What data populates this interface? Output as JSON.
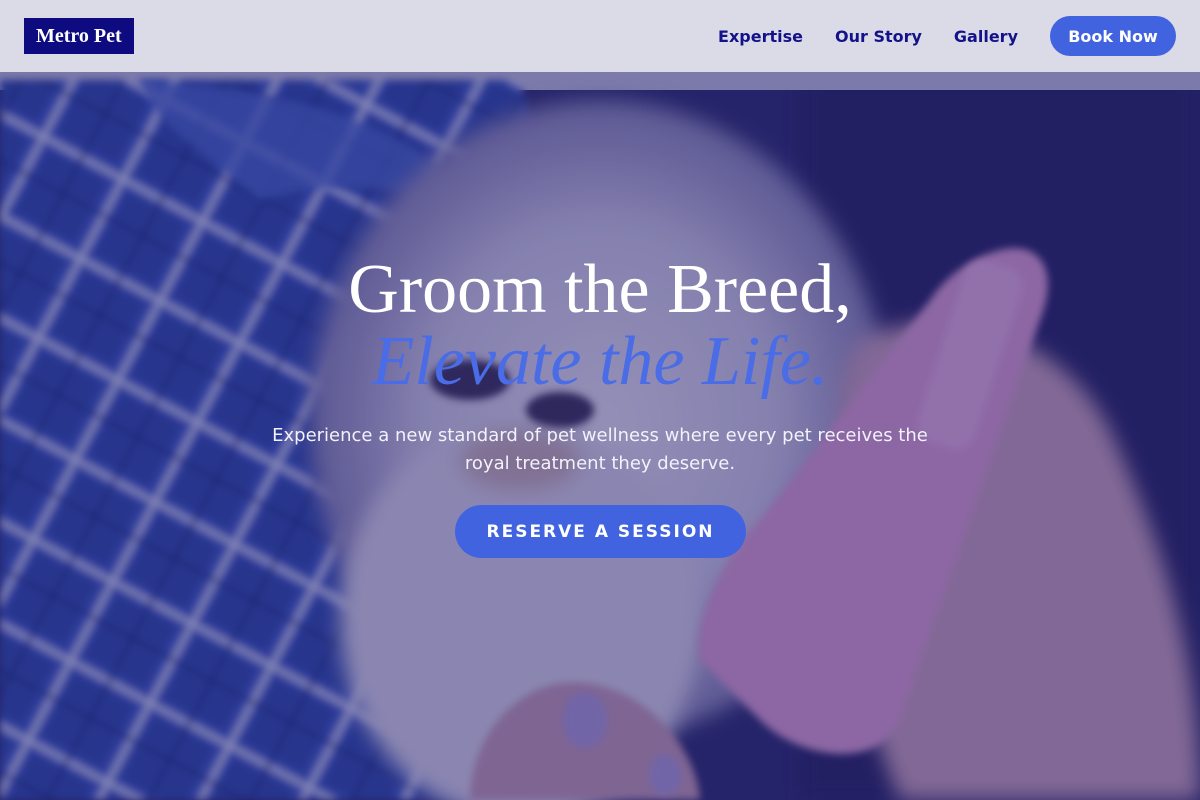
{
  "header": {
    "logo_text": "Metro Pet",
    "nav": [
      {
        "label": "Expertise"
      },
      {
        "label": "Our Story"
      },
      {
        "label": "Gallery"
      }
    ],
    "cta_label": "Book Now"
  },
  "hero": {
    "headline_line1": "Groom the Breed,",
    "headline_line2": "Elevate the Life.",
    "subtitle": "Experience a new standard of pet wellness where every pet receives the royal treatment they deserve.",
    "cta_label": "RESERVE A SESSION",
    "background_image": "blurred photo of a fluffy white dog wrapped in a blue plaid blanket being brushed with a pink brush"
  },
  "colors": {
    "brand_navy": "#0d0b7f",
    "accent_blue": "#4263e0",
    "header_bg": "#dedee8"
  }
}
